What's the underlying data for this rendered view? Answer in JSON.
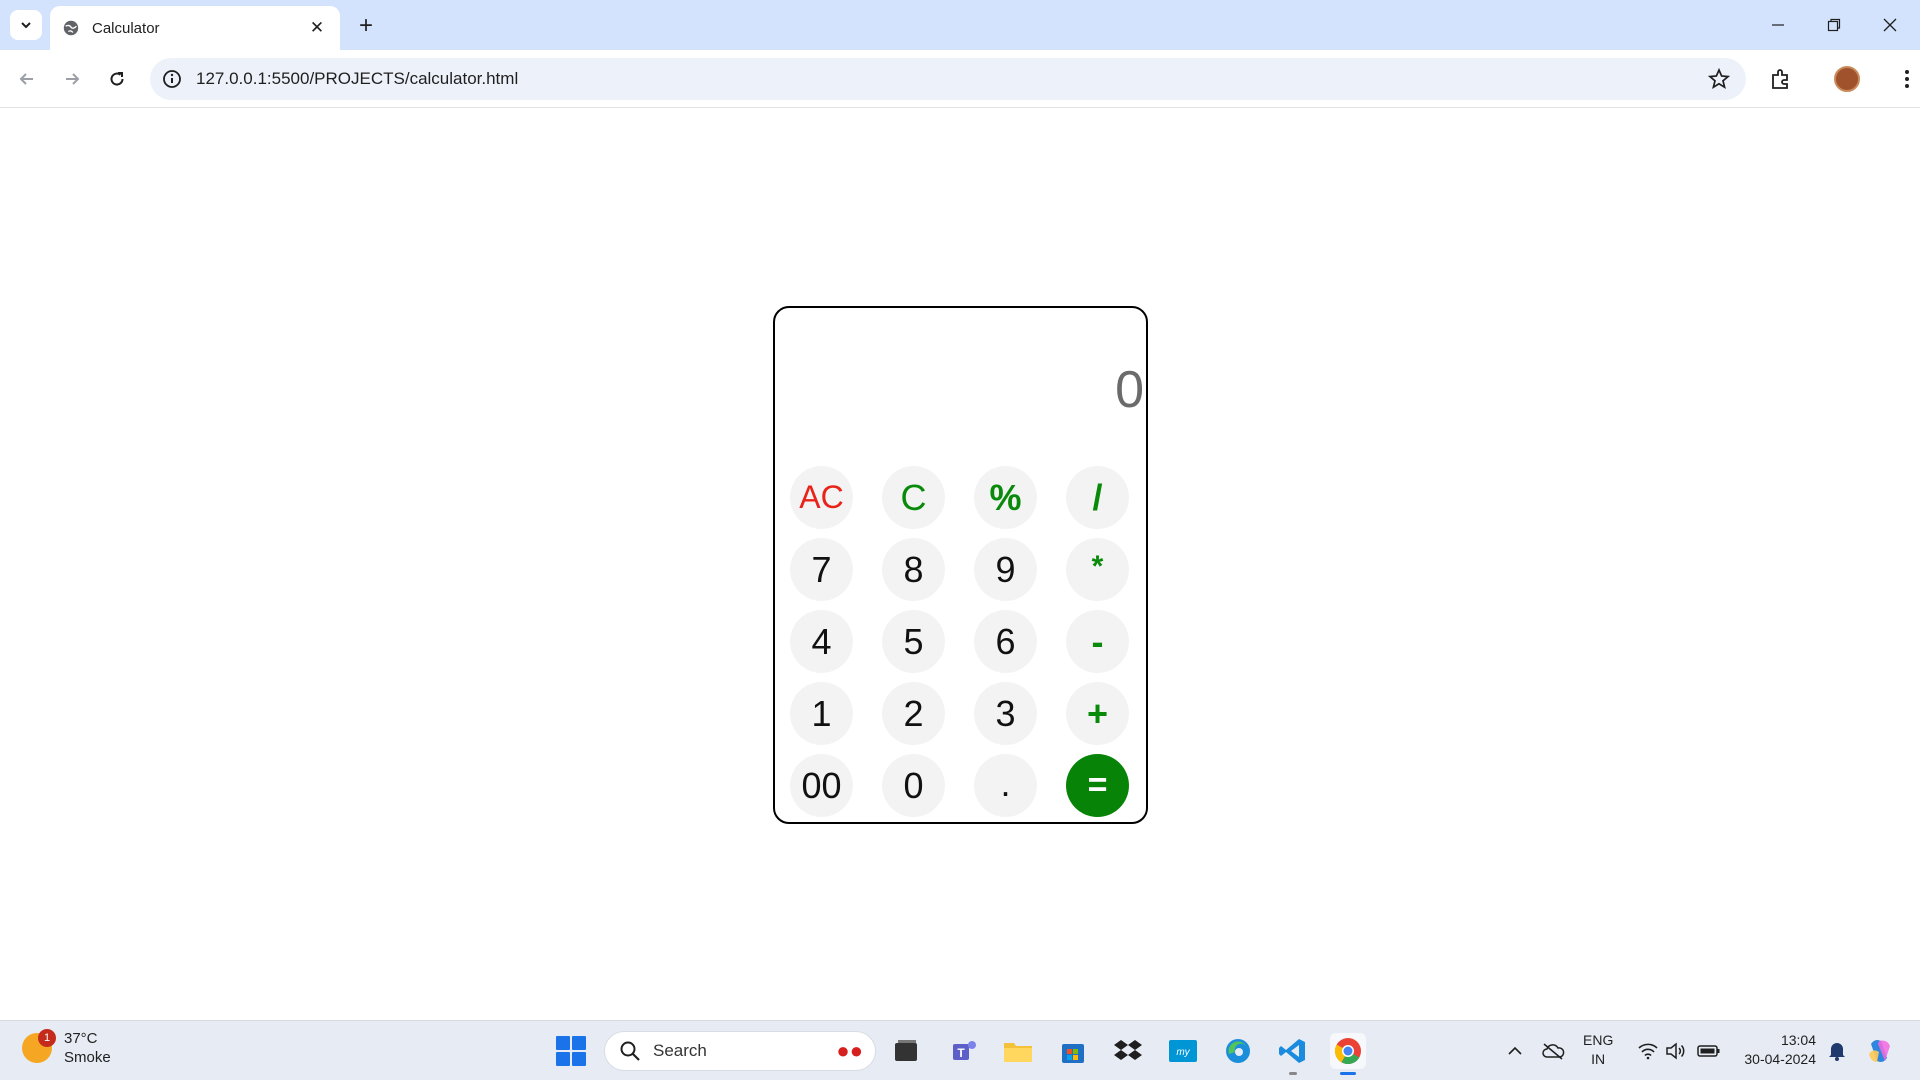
{
  "browser": {
    "tab_title": "Calculator",
    "url": "127.0.0.1:5500/PROJECTS/calculator.html"
  },
  "calculator": {
    "display": "0",
    "keys": {
      "ac": "AC",
      "c": "C",
      "percent": "%",
      "divide": "/",
      "seven": "7",
      "eight": "8",
      "nine": "9",
      "multiply": "*",
      "four": "4",
      "five": "5",
      "six": "6",
      "minus": "-",
      "one": "1",
      "two": "2",
      "three": "3",
      "plus": "+",
      "double_zero": "00",
      "zero": "0",
      "dot": ".",
      "equals": "="
    },
    "colors": {
      "clear": "#e8231a",
      "operator": "#0a8a0a",
      "equals_bg": "#078407"
    }
  },
  "taskbar": {
    "weather_temp": "37°C",
    "weather_desc": "Smoke",
    "weather_badge": "1",
    "search_label": "Search",
    "lang_line1": "ENG",
    "lang_line2": "IN",
    "time": "13:04",
    "date": "30-04-2024"
  }
}
